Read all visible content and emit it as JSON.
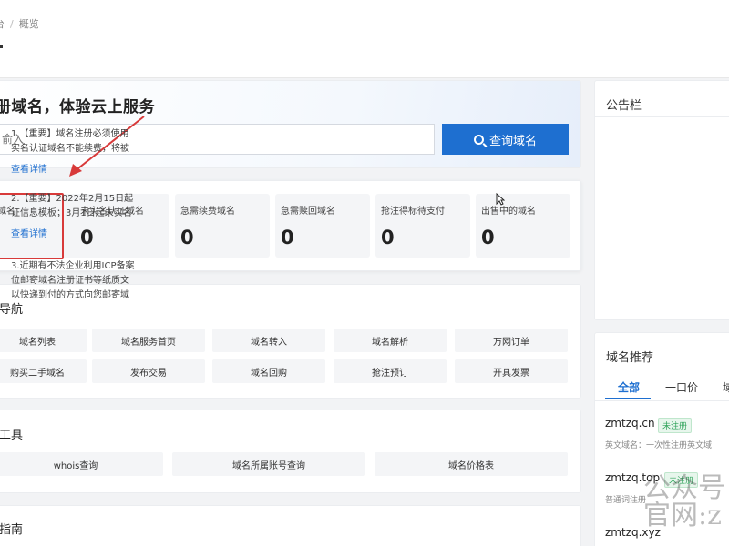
{
  "breadcrumb": {
    "parent": "台",
    "separator": "/",
    "current": "概览"
  },
  "hero": {
    "title": "册域名，体验云上服务",
    "input_placeholder": "俞入",
    "button_label": "查询域名"
  },
  "stats": [
    {
      "label": "域名",
      "value": ""
    },
    {
      "label": "未实名认证域名",
      "value": "0"
    },
    {
      "label": "急需续费域名",
      "value": "0"
    },
    {
      "label": "急需赎回域名",
      "value": "0"
    },
    {
      "label": "抢注得标待支付",
      "value": "0"
    },
    {
      "label": "出售中的域名",
      "value": "0"
    }
  ],
  "quick_nav": {
    "title": "导航",
    "row1": [
      "域名列表",
      "域名服务首页",
      "域名转入",
      "域名解析",
      "万网订单"
    ],
    "row2": [
      "购买二手域名",
      "发布交易",
      "域名回购",
      "抢注预订",
      "开具发票"
    ]
  },
  "tools": {
    "title": "工具",
    "items": [
      "whois查询",
      "域名所属账号查询",
      "域名价格表"
    ]
  },
  "guide": {
    "title": "指南"
  },
  "notice": {
    "title": "公告栏",
    "items": [
      {
        "line1": "1.【重要】域名注册必须使用",
        "line2": "实名认证域名不能续费，将被",
        "link": "查看详情"
      },
      {
        "line1": "2.【重要】2022年2月15日起",
        "line2": "证信息模板；3月1日起未实名",
        "link": "查看详情"
      },
      {
        "line1": "3.近期有不法企业利用ICP备案",
        "line2": "位邮寄域名注册证书等纸质文",
        "line3": "以快递到付的方式向您邮寄域"
      }
    ]
  },
  "recommend": {
    "title": "域名推荐",
    "tabs": [
      "全部",
      "一口价",
      "域"
    ],
    "domains": [
      {
        "name": "zmtzq.cn",
        "badge": "未注册",
        "desc": "英文域名：一次性注册英文域"
      },
      {
        "name": "zmtzq.top",
        "badge": "未注册",
        "desc": "普通词注册"
      },
      {
        "name": "zmtzq.xyz",
        "badge": "",
        "desc": ""
      }
    ]
  },
  "watermark": {
    "line1": "公众号",
    "line2": "官网:z"
  },
  "colors": {
    "accent": "#1e6fd0",
    "highlight": "#d83a3a",
    "badge": "#2fa35a"
  }
}
